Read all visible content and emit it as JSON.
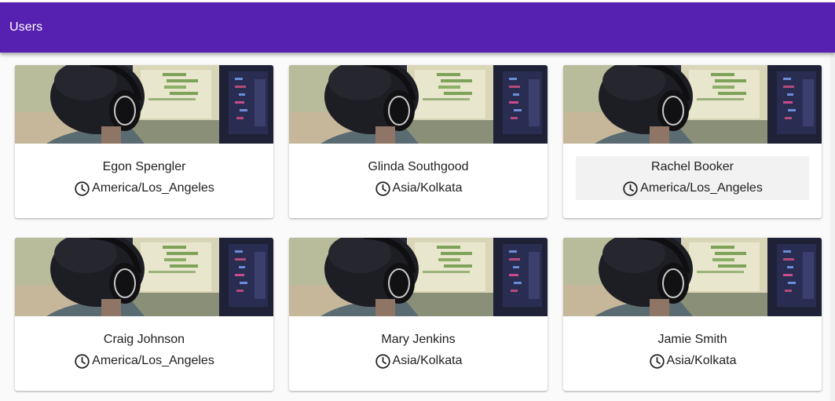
{
  "appbar": {
    "title": "Users",
    "color": "#5620b0"
  },
  "cards": [
    {
      "name": "Egon Spengler",
      "timezone": "America/Los_Angeles",
      "icon": "clock-icon"
    },
    {
      "name": "Glinda Southgood",
      "timezone": "Asia/Kolkata",
      "icon": "clock-icon"
    },
    {
      "name": "Rachel Booker",
      "timezone": "America/Los_Angeles",
      "icon": "clock-icon",
      "focused": true
    },
    {
      "name": "Craig Johnson",
      "timezone": "America/Los_Angeles",
      "icon": "clock-icon"
    },
    {
      "name": "Mary Jenkins",
      "timezone": "Asia/Kolkata",
      "icon": "clock-icon"
    },
    {
      "name": "Jamie Smith",
      "timezone": "Asia/Kolkata",
      "icon": "clock-icon"
    }
  ]
}
